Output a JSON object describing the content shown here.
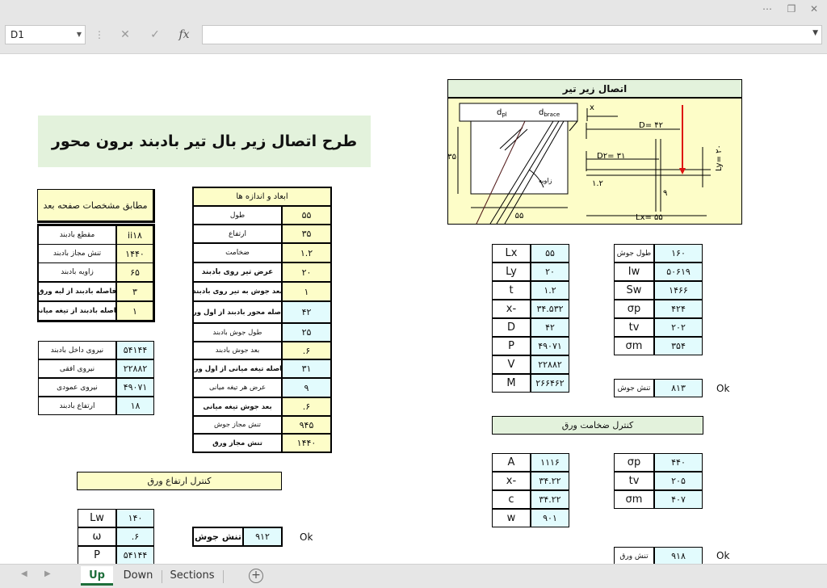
{
  "window": {
    "more_icon": "⋯",
    "restore_icon": "❐",
    "min_icon": "—",
    "close_icon": "✕"
  },
  "formula_bar": {
    "name_box": "D1",
    "cancel_icon": "✕",
    "enter_icon": "✓",
    "fx_label": "fx",
    "formula": ""
  },
  "title": "طرح اتصال زیر بال تیر بادبند برون محور",
  "note_box": "مطابق مشخصات صفحه بعد",
  "brace_props": [
    {
      "value": "ii۱۸",
      "label": "مقطع بادبند"
    },
    {
      "value": "۱۴۴۰",
      "label": "تنش مجاز بادبند"
    },
    {
      "value": "۶۵",
      "label": "زاویه بادبند"
    },
    {
      "value": "۳",
      "label": "فاصله بادبند از لبه ورق"
    },
    {
      "value": "۱",
      "label": "فاصله بادبند از تیغه میانی"
    }
  ],
  "forces": [
    {
      "value": "۵۴۱۴۴",
      "label": "نیروی داخل بادبند"
    },
    {
      "value": "۲۲۸۸۲",
      "label": "نیروی افقی"
    },
    {
      "value": "۴۹۰۷۱",
      "label": "نیروی عمودی"
    },
    {
      "value": "۱۸",
      "label": "ارتفاع بادبند"
    }
  ],
  "dims": {
    "header": "ابعاد و اندازه ها",
    "rows": [
      {
        "label": "طول",
        "value": "۵۵"
      },
      {
        "label": "ارتفاع",
        "value": "۳۵"
      },
      {
        "label": "ضخامت",
        "value": "۱.۲"
      },
      {
        "label": "عرض تیر روی بادبند",
        "value": "۲۰"
      },
      {
        "label": "بعد جوش به تیر روی بادبند",
        "value": "۱"
      },
      {
        "label": "فاصله محور بادبند از اول ورق",
        "value": "۴۲"
      },
      {
        "label": "طول جوش بادبند",
        "value": "۲۵"
      },
      {
        "label": "بعد جوش بادبند",
        "value": ".۶"
      },
      {
        "label": "فاصله تیغه میانی از اول ورق",
        "value": "۳۱"
      },
      {
        "label": "عرض هر تیغه میانی",
        "value": "۹"
      },
      {
        "label": "بعد جوش تیغه میانی",
        "value": ".۶"
      },
      {
        "label": "تنش مجاز جوش",
        "value": "۹۴۵"
      },
      {
        "label": "تنش مجاز ورق",
        "value": "۱۴۴۰"
      }
    ]
  },
  "height_check": {
    "header": "کنترل ارتفاع ورق",
    "rows": [
      {
        "sym": "Lw",
        "value": "۱۴۰"
      },
      {
        "sym": "ω",
        "value": ".۶"
      },
      {
        "sym": "P",
        "value": "۵۴۱۴۴"
      }
    ],
    "stress_label": "تنش جوش",
    "stress_value": "۹۱۲",
    "status": "Ok"
  },
  "diagram": {
    "title": "اتصال زیر تیر",
    "x_label": "x",
    "d_pl": "d",
    "d_pl_sub": "pl",
    "d_brace": "d",
    "d_brace_sub": "brace",
    "D": "D= ۴۲",
    "D2": "D۲= ۳۱",
    "h35": "۳۵",
    "t12": "۱.۲",
    "n9": "۹",
    "zavie": "زاویه",
    "b55": "۵۵",
    "Lx": "Lx= ۵۵",
    "Ly": "Ly= ۲۰"
  },
  "geom_table": [
    {
      "sym": "Lx",
      "value": "۵۵"
    },
    {
      "sym": "Ly",
      "value": "۲۰"
    },
    {
      "sym": "t",
      "value": "۱.۲"
    },
    {
      "sym": "x-",
      "value": "۳۴.۵۳۲"
    },
    {
      "sym": "D",
      "value": "۴۲"
    },
    {
      "sym": "P",
      "value": "۴۹۰۷۱"
    },
    {
      "sym": "V",
      "value": "۲۲۸۸۲"
    },
    {
      "sym": "M",
      "value": "۲۶۶۴۶۲"
    }
  ],
  "weld_table": [
    {
      "sym": "طول جوش",
      "value": "۱۶۰"
    },
    {
      "sym": "Iw",
      "value": "۵۰۶۱۹"
    },
    {
      "sym": "Sw",
      "value": "۱۴۶۶"
    },
    {
      "sym": "σp",
      "value": "۴۲۴"
    },
    {
      "sym": "tv",
      "value": "۲۰۲"
    },
    {
      "sym": "σm",
      "value": "۳۵۴"
    }
  ],
  "weld_stress": {
    "label": "تنش جوش",
    "value": "۸۱۳",
    "status": "Ok"
  },
  "thickness_check": {
    "header": "کنترل ضخامت ورق",
    "left": [
      {
        "sym": "A",
        "value": "۱۱۱۶"
      },
      {
        "sym": "x-",
        "value": "۳۴.۲۲"
      },
      {
        "sym": "c",
        "value": "۳۴.۲۲"
      },
      {
        "sym": "w",
        "value": "۹۰۱"
      }
    ],
    "right": [
      {
        "sym": "σp",
        "value": "۴۴۰"
      },
      {
        "sym": "tv",
        "value": "۲۰۵"
      },
      {
        "sym": "σm",
        "value": "۴۰۷"
      }
    ],
    "stress_label": "تنش ورق",
    "stress_value": "۹۱۸",
    "status": "Ok"
  },
  "tabs": [
    {
      "label": "Up"
    },
    {
      "label": "Down"
    },
    {
      "label": "Sections"
    }
  ],
  "add_sheet": "+"
}
